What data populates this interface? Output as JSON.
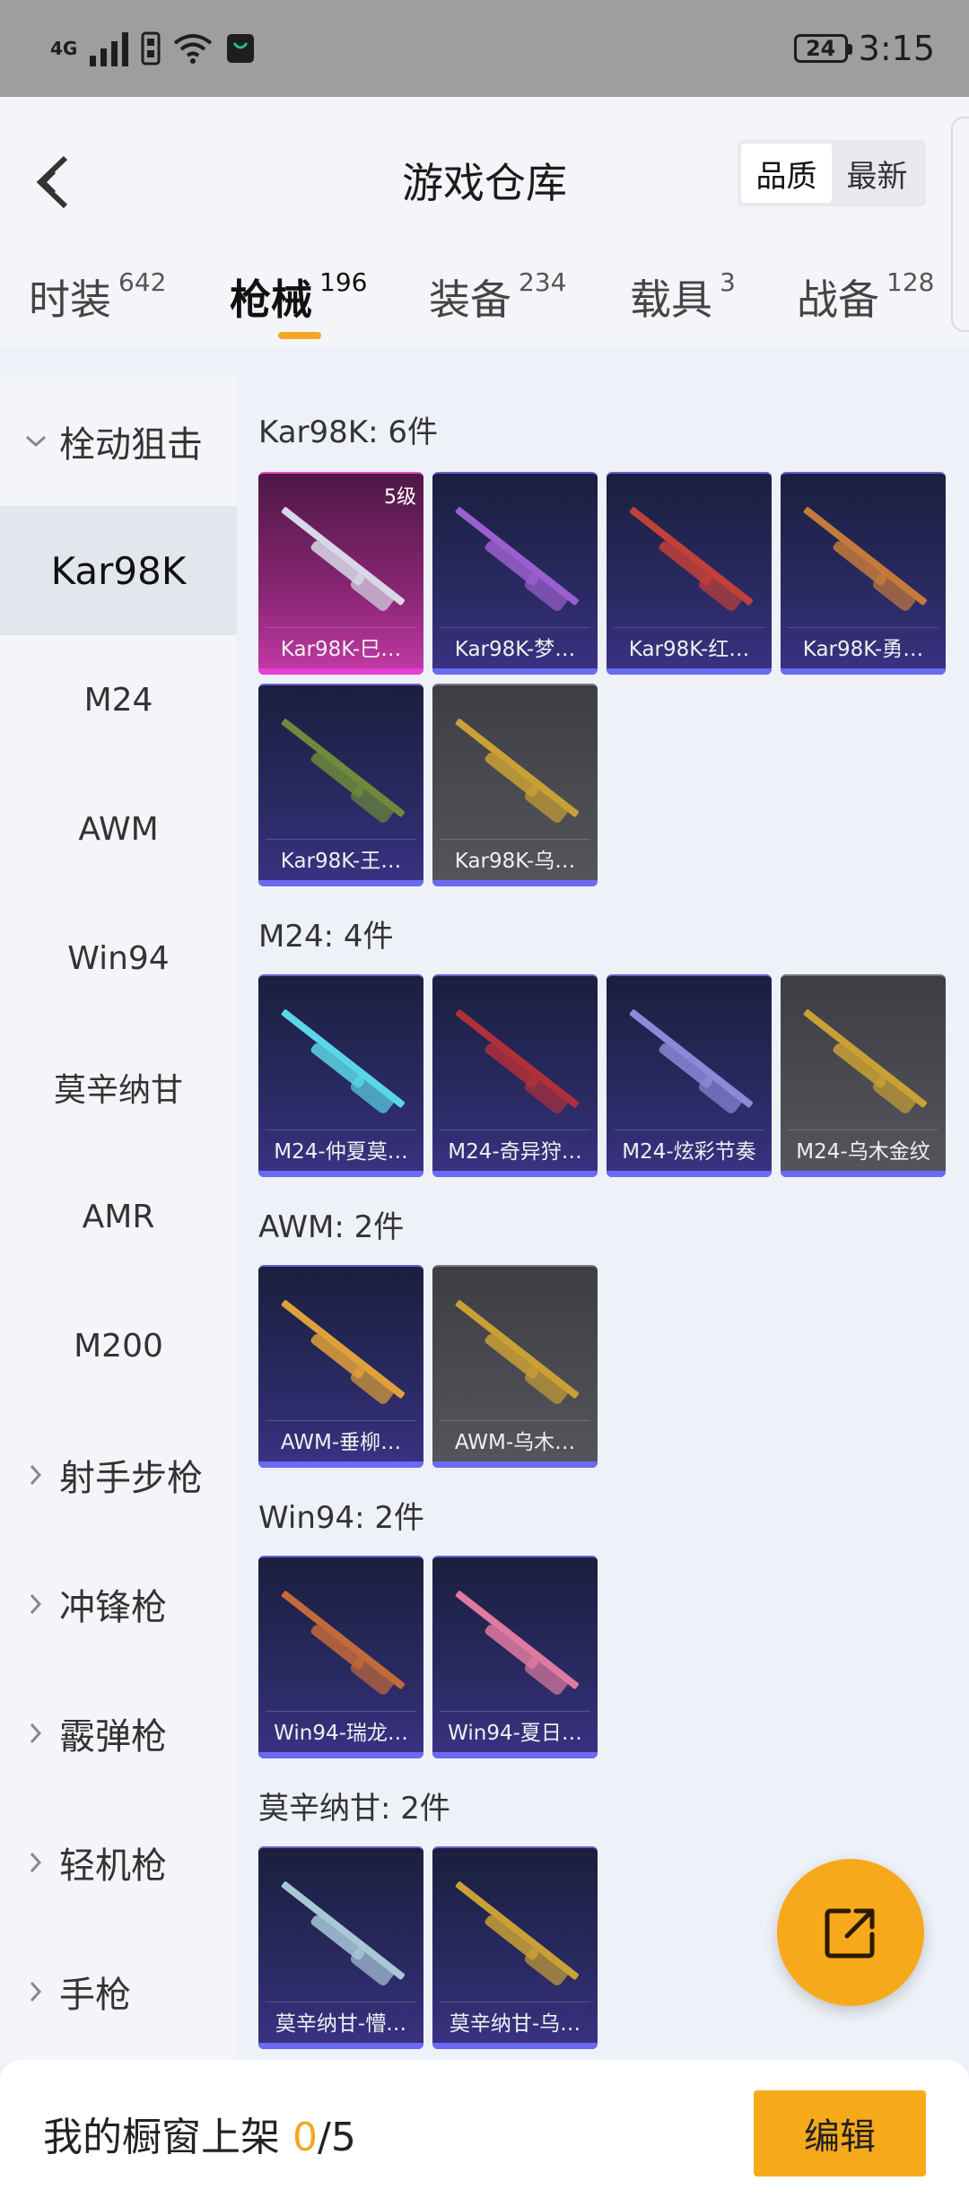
{
  "status_bar": {
    "network": "4G",
    "battery": "24",
    "time": "3:15"
  },
  "header": {
    "title": "游戏仓库",
    "sort_options": [
      "品质",
      "最新"
    ],
    "active_sort": "品质"
  },
  "tabs": [
    {
      "label": "时装",
      "count": "642"
    },
    {
      "label": "枪械",
      "count": "196"
    },
    {
      "label": "装备",
      "count": "234"
    },
    {
      "label": "载具",
      "count": "3"
    },
    {
      "label": "战备",
      "count": "128"
    }
  ],
  "active_tab": "枪械",
  "accent_color": "#f5a623",
  "sidebar": {
    "items": [
      {
        "label": "栓动狙击",
        "type": "group",
        "expanded": true
      },
      {
        "label": "Kar98K",
        "type": "sub",
        "active": true
      },
      {
        "label": "M24",
        "type": "sub"
      },
      {
        "label": "AWM",
        "type": "sub"
      },
      {
        "label": "Win94",
        "type": "sub"
      },
      {
        "label": "莫辛纳甘",
        "type": "sub"
      },
      {
        "label": "AMR",
        "type": "sub"
      },
      {
        "label": "M200",
        "type": "sub"
      },
      {
        "label": "射手步枪",
        "type": "group"
      },
      {
        "label": "冲锋枪",
        "type": "group"
      },
      {
        "label": "霰弹枪",
        "type": "group"
      },
      {
        "label": "轻机枪",
        "type": "group"
      },
      {
        "label": "手枪",
        "type": "group"
      }
    ]
  },
  "sections": [
    {
      "title": "Kar98K: 6件",
      "items": [
        {
          "name": "Kar98K-巳…",
          "rarity": "pink",
          "level": "5级",
          "gun_color": "#d8d8e8"
        },
        {
          "name": "Kar98K-梦…",
          "rarity": "purple",
          "gun_color": "#9b5fd0"
        },
        {
          "name": "Kar98K-红…",
          "rarity": "purple",
          "gun_color": "#c2403a"
        },
        {
          "name": "Kar98K-勇…",
          "rarity": "purple",
          "gun_color": "#c47a3a"
        },
        {
          "name": "Kar98K-王…",
          "rarity": "purple",
          "gun_color": "#6e8a3a"
        },
        {
          "name": "Kar98K-乌…",
          "rarity": "grey",
          "gun_color": "#c9a035"
        }
      ]
    },
    {
      "title": "M24: 4件",
      "items": [
        {
          "name": "M24-仲夏莫…",
          "rarity": "purple",
          "gun_color": "#5ad6e8"
        },
        {
          "name": "M24-奇异狩…",
          "rarity": "purple",
          "gun_color": "#b0303a"
        },
        {
          "name": "M24-炫彩节奏",
          "rarity": "purple",
          "gun_color": "#8a8ad8"
        },
        {
          "name": "M24-乌木金纹",
          "rarity": "grey",
          "gun_color": "#c9a035"
        }
      ]
    },
    {
      "title": "AWM: 2件",
      "items": [
        {
          "name": "AWM-垂柳…",
          "rarity": "purple",
          "gun_color": "#e0a03a"
        },
        {
          "name": "AWM-乌木…",
          "rarity": "grey",
          "gun_color": "#c9a035"
        }
      ]
    },
    {
      "title": "Win94: 2件",
      "items": [
        {
          "name": "Win94-瑞龙…",
          "rarity": "purple",
          "gun_color": "#c46a3a"
        },
        {
          "name": "Win94-夏日…",
          "rarity": "purple",
          "gun_color": "#e07aa0"
        }
      ]
    },
    {
      "title": "莫辛纳甘: 2件",
      "items": [
        {
          "name": "莫辛纳甘-懵…",
          "rarity": "purple",
          "gun_color": "#a8c8d8"
        },
        {
          "name": "莫辛纳甘-乌…",
          "rarity": "purple",
          "gun_color": "#c9a035"
        }
      ]
    }
  ],
  "bottom_bar": {
    "label": "我的橱窗上架",
    "shelved": "0",
    "capacity": "/5",
    "edit_label": "编辑"
  }
}
